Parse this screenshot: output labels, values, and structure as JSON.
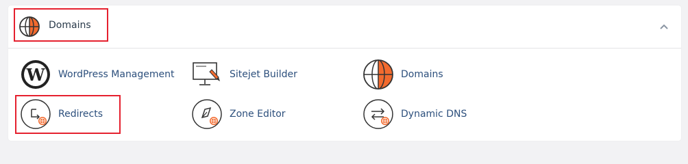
{
  "section": {
    "title": "Domains",
    "icon": "globe-icon",
    "collapse_icon": "chevron-up-icon"
  },
  "items": [
    {
      "label": "WordPress Management",
      "icon": "wordpress-icon"
    },
    {
      "label": "Sitejet Builder",
      "icon": "monitor-pen-icon"
    },
    {
      "label": "Domains",
      "icon": "globe-icon"
    },
    {
      "label": "Redirects",
      "icon": "redirect-icon"
    },
    {
      "label": "Zone Editor",
      "icon": "zone-editor-icon"
    },
    {
      "label": "Dynamic DNS",
      "icon": "dynamic-dns-icon"
    }
  ],
  "colors": {
    "accent": "#f26a2e",
    "link": "#2c4f7c",
    "highlight": "#e5202e",
    "icon_stroke": "#333333"
  }
}
